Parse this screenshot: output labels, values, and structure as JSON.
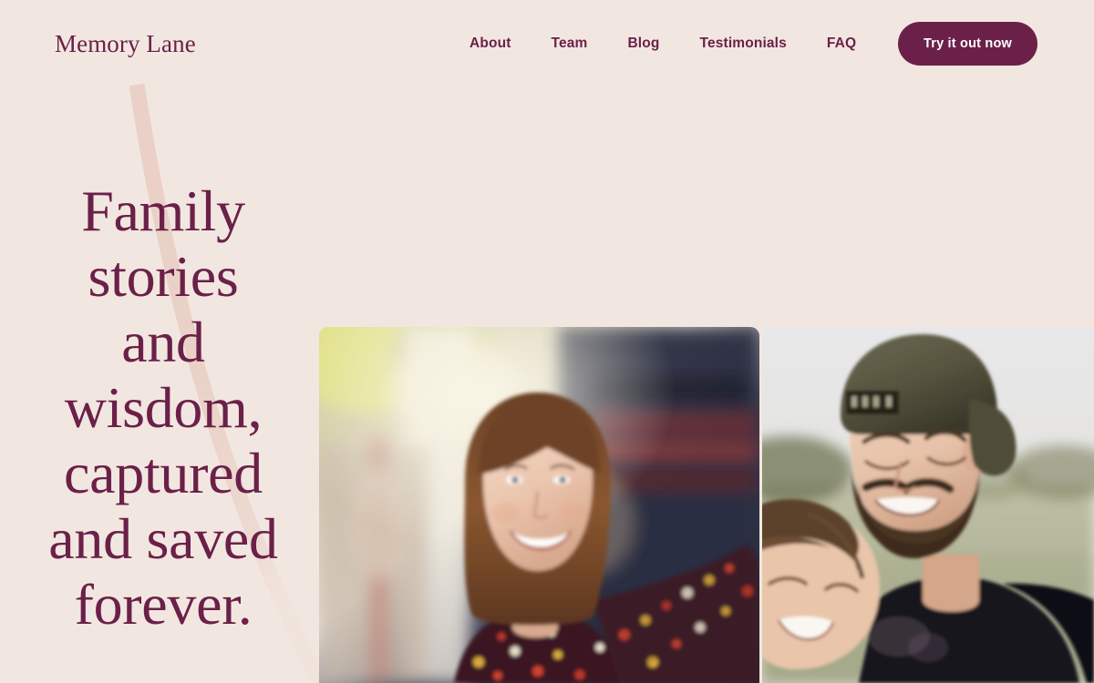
{
  "theme": {
    "page_background": "#F2E7E0",
    "brand_color": "#6B2049",
    "curve_color": "#E9CFC5",
    "button_text_color": "#FFFFFF"
  },
  "header": {
    "brand": "Memory Lane",
    "nav_items": [
      {
        "label": "About"
      },
      {
        "label": "Team"
      },
      {
        "label": "Blog"
      },
      {
        "label": "Testimonials"
      },
      {
        "label": "FAQ"
      }
    ],
    "cta_label": "Try it out now"
  },
  "hero": {
    "heading": "Family stories and wisdom, captured and saved forever.",
    "heading_lines": [
      "Family",
      "stories",
      "and",
      "wisdom,",
      "captured",
      "and",
      "saved",
      "forever."
    ],
    "images": [
      {
        "name": "smiling-woman-photo",
        "alt": "Smiling woman with brown bob haircut and bangs wearing a colorful floral patterned top, blurred street background"
      },
      {
        "name": "father-and-child-photo",
        "alt": "Bearded man in a backwards cap smiling while holding a laughing child in a sunlit field"
      }
    ]
  }
}
